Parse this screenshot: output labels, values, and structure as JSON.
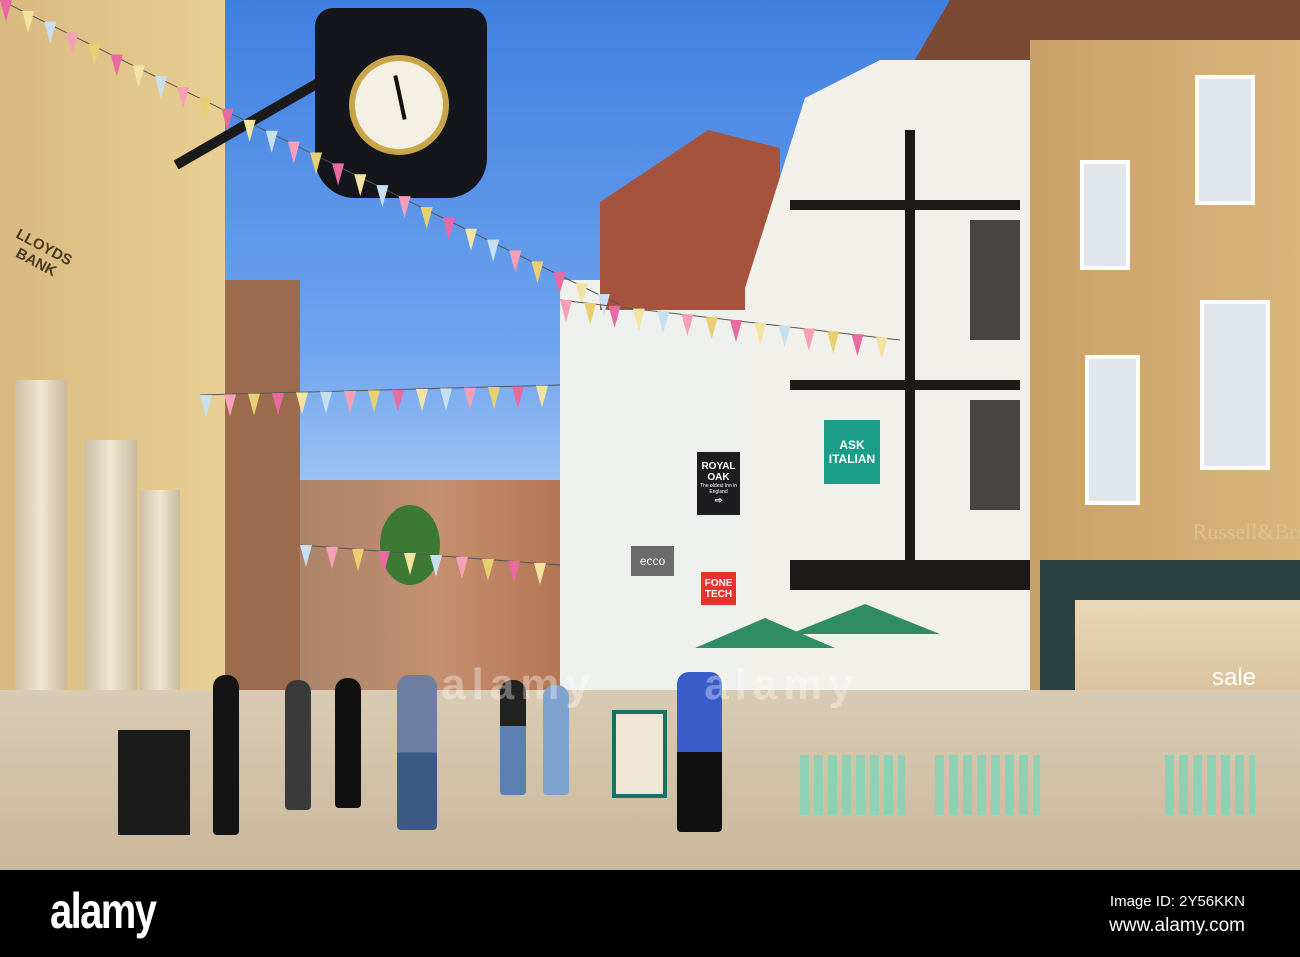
{
  "photo": {
    "description_visible_text": {
      "lloyds_sign": "LLOYDS BANK",
      "royal_oak_title": "ROYAL OAK",
      "royal_oak_sub": "The oldest Inn in England",
      "royal_oak_arrow": "⇨",
      "ask_italian_line1": "ASK",
      "ask_italian_line2": "ITALIAN",
      "fone_tech_line1": "FONE",
      "fone_tech_line2": "TECH",
      "ecco_sign": "ecco",
      "russell_sign": "Russell&Bro",
      "sale_sign": "sale"
    }
  },
  "watermark": {
    "text": "alamy"
  },
  "footer": {
    "logo": "alamy",
    "image_id": "Image ID: 2Y56KKN",
    "url": "www.alamy.com"
  },
  "colors": {
    "sky": "#4f8ae6",
    "ask_italian": "#1a9c86",
    "fone_tech": "#e8322b"
  }
}
